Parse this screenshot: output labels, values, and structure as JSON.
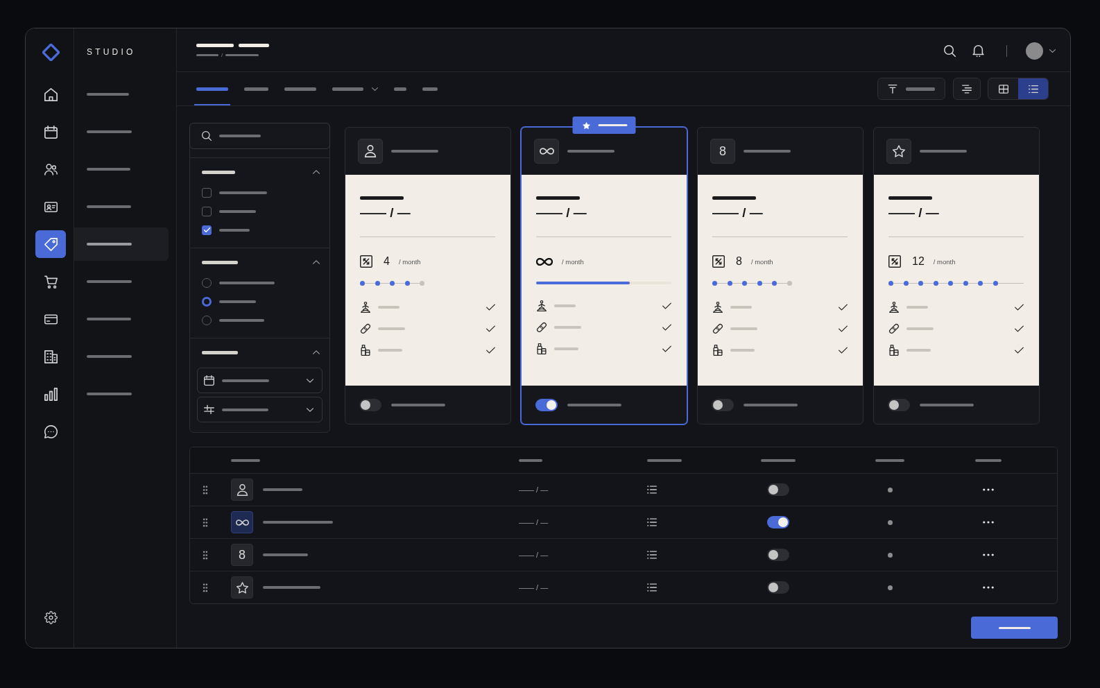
{
  "rail": {
    "items": [
      {
        "selected": false
      },
      {
        "selected": false
      },
      {
        "selected": false
      },
      {
        "selected": false
      },
      {
        "selected": true
      },
      {
        "selected": false
      },
      {
        "selected": false
      },
      {
        "selected": false
      },
      {
        "selected": false
      },
      {
        "selected": false
      }
    ]
  },
  "sidebar": {
    "brand": "STUDIO",
    "items": [
      {
        "selected": false
      },
      {
        "selected": false
      },
      {
        "selected": false
      },
      {
        "selected": false
      },
      {
        "selected": true
      },
      {
        "selected": false
      },
      {
        "selected": false
      },
      {
        "selected": false
      },
      {
        "selected": false
      }
    ]
  },
  "header": {
    "breadcrumb_separator": "/"
  },
  "tabs": [
    {
      "kind": "plain",
      "selected": true
    },
    {
      "kind": "plain",
      "selected": false
    },
    {
      "kind": "plain",
      "selected": false
    },
    {
      "kind": "dropdown",
      "selected": false
    },
    {
      "kind": "plain",
      "selected": false
    },
    {
      "kind": "plain",
      "selected": false
    }
  ],
  "toolbar": {
    "view_modes": [
      {
        "selected": false
      },
      {
        "selected": true
      }
    ]
  },
  "filters": {
    "sections": [
      {
        "kind": "checkbox",
        "expanded": true,
        "options": [
          {
            "checked": false
          },
          {
            "checked": false
          },
          {
            "checked": true
          }
        ]
      },
      {
        "kind": "radio",
        "expanded": true,
        "options": [
          {
            "selected": false
          },
          {
            "selected": true
          },
          {
            "selected": false
          }
        ]
      },
      {
        "kind": "select",
        "expanded": true,
        "fields": [
          {
            "kind": "date"
          },
          {
            "kind": "range"
          }
        ]
      }
    ]
  },
  "plans": [
    {
      "selected": false,
      "featured": false,
      "kind": "metered",
      "price": "—— / —",
      "quota": "4",
      "unit": "/ month",
      "steps": [
        {
          "on": true
        },
        {
          "on": true
        },
        {
          "on": true
        },
        {
          "on": true
        },
        {
          "on": false
        }
      ],
      "open_ended": false,
      "features": [
        {
          "included": true
        },
        {
          "included": true
        },
        {
          "included": true
        }
      ],
      "enabled": false
    },
    {
      "selected": true,
      "featured": true,
      "kind": "unlimited",
      "price": "—— / —",
      "unit": "/ month",
      "level": 0.69,
      "features": [
        {
          "included": true
        },
        {
          "included": true
        },
        {
          "included": true
        }
      ],
      "enabled": true
    },
    {
      "selected": false,
      "featured": false,
      "kind": "metered",
      "glyph": "8",
      "price": "—— / —",
      "quota": "8",
      "unit": "/ month",
      "steps": [
        {
          "on": true
        },
        {
          "on": true
        },
        {
          "on": true
        },
        {
          "on": true
        },
        {
          "on": true
        },
        {
          "on": false
        }
      ],
      "open_ended": false,
      "features": [
        {
          "included": true
        },
        {
          "included": true
        },
        {
          "included": true
        }
      ],
      "enabled": false
    },
    {
      "selected": false,
      "featured": false,
      "kind": "metered",
      "price": "—— / —",
      "quota": "12",
      "unit": "/ month",
      "steps": [
        {
          "on": true
        },
        {
          "on": true
        },
        {
          "on": true
        },
        {
          "on": true
        },
        {
          "on": true
        },
        {
          "on": true
        },
        {
          "on": true
        },
        {
          "on": true
        }
      ],
      "open_ended": true,
      "features": [
        {
          "included": true
        },
        {
          "included": true
        },
        {
          "included": true
        }
      ],
      "enabled": false
    }
  ],
  "table": {
    "rows": [
      {
        "featured": false,
        "price": "—— / —",
        "enabled": false
      },
      {
        "featured": true,
        "price": "—— / —",
        "enabled": true
      },
      {
        "featured": false,
        "glyph": "8",
        "price": "—— / —",
        "enabled": false
      },
      {
        "featured": false,
        "price": "—— / —",
        "enabled": false
      }
    ]
  }
}
